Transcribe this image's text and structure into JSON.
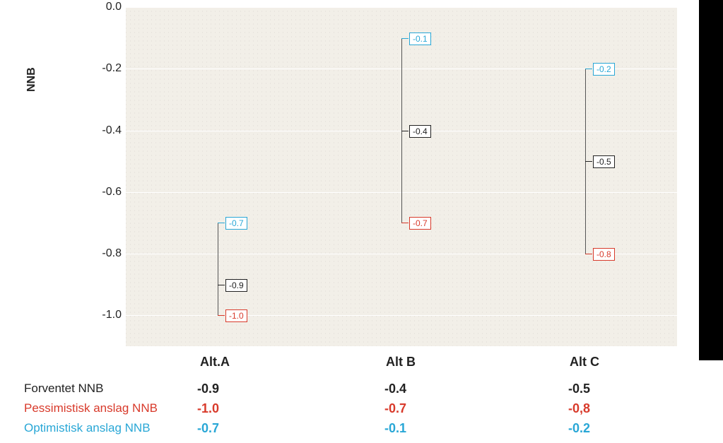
{
  "chart_data": {
    "type": "stock",
    "ylabel": "NNB",
    "ylim": [
      -1.1,
      0.0
    ],
    "yticks": [
      0.0,
      -0.2,
      -0.4,
      -0.6,
      -0.8,
      -1.0
    ],
    "categories": [
      "Alt.A",
      "Alt B",
      "Alt C"
    ],
    "series": [
      {
        "name": "Optimistisk anslag NNB",
        "role": "optimistic",
        "color": "#29a7d6",
        "values": [
          -0.7,
          -0.1,
          -0.2
        ],
        "display": [
          "-0.7",
          "-0.1",
          "-0.2"
        ]
      },
      {
        "name": "Forventet NNB",
        "role": "expected",
        "color": "#222222",
        "values": [
          -0.9,
          -0.4,
          -0.5
        ],
        "display": [
          "-0.9",
          "-0.4",
          "-0.5"
        ]
      },
      {
        "name": "Pessimistisk anslag NNB",
        "role": "pessimistic",
        "color": "#d83a2b",
        "values": [
          -1.0,
          -0.7,
          -0.8
        ],
        "display": [
          "-1.0",
          "-0.7",
          "-0,8"
        ]
      }
    ]
  },
  "ylabel": "NNB",
  "yticks": {
    "0": "0.0",
    "1": "-0.2",
    "2": "-0.4",
    "3": "-0.6",
    "4": "-0.8",
    "5": "-1.0"
  },
  "cats": {
    "0": "Alt.A",
    "1": "Alt B",
    "2": "Alt C"
  },
  "labels": {
    "a": {
      "opt": "-0.7",
      "for": "-0.9",
      "pes": "-1.0"
    },
    "b": {
      "opt": "-0.1",
      "for": "-0.4",
      "pes": "-0.7"
    },
    "c": {
      "opt": "-0.2",
      "for": "-0.5",
      "pes": "-0.8"
    }
  },
  "table": {
    "rows": [
      {
        "label": "Forventet NNB",
        "class": "for-c",
        "vals": [
          "-0.9",
          "-0.4",
          "-0.5"
        ]
      },
      {
        "label": "Pessimistisk anslag NNB",
        "class": "pes-c",
        "vals": [
          "-1.0",
          "-0.7",
          "-0,8"
        ]
      },
      {
        "label": "Optimistisk anslag NNB",
        "class": "opt-c",
        "vals": [
          "-0.7",
          "-0.1",
          "-0.2"
        ]
      }
    ]
  }
}
